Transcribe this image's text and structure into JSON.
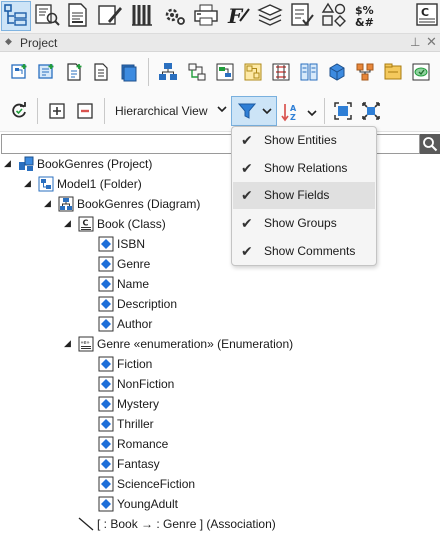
{
  "panel": {
    "title": "Project"
  },
  "top_toolbar": {
    "icons": [
      "model-explorer-icon",
      "search-model-icon",
      "document-icon",
      "edit-diagram-icon",
      "generate-code-icon",
      "settings-icon",
      "print-icon",
      "functions-icon",
      "layers-icon",
      "checklist-icon",
      "shapes-icon",
      "variables-icon",
      "class-c-icon"
    ]
  },
  "toolbar": {
    "view_mode": "Hierarchical View"
  },
  "search": {
    "value": "",
    "placeholder": ""
  },
  "tree": [
    {
      "label": "BookGenres (Project)",
      "icon": "project-icon",
      "expanded": true
    },
    {
      "label": "Model1 (Folder)",
      "icon": "folder-icon",
      "expanded": true
    },
    {
      "label": "BookGenres (Diagram)",
      "icon": "diagram-icon",
      "expanded": true
    },
    {
      "label": "Book (Class)",
      "icon": "class-icon",
      "expanded": true
    },
    {
      "label": "ISBN",
      "icon": "field-icon"
    },
    {
      "label": "Genre",
      "icon": "field-icon"
    },
    {
      "label": "Name",
      "icon": "field-icon"
    },
    {
      "label": "Description",
      "icon": "field-icon"
    },
    {
      "label": "Author",
      "icon": "field-icon"
    },
    {
      "label": "Genre «enumeration» (Enumeration)",
      "icon": "enumeration-icon",
      "expanded": true
    },
    {
      "label": "Fiction",
      "icon": "field-icon"
    },
    {
      "label": "NonFiction",
      "icon": "field-icon"
    },
    {
      "label": "Mystery",
      "icon": "field-icon"
    },
    {
      "label": "Thriller",
      "icon": "field-icon"
    },
    {
      "label": "Romance",
      "icon": "field-icon"
    },
    {
      "label": "Fantasy",
      "icon": "field-icon"
    },
    {
      "label": "ScienceFiction",
      "icon": "field-icon"
    },
    {
      "label": "YoungAdult",
      "icon": "field-icon"
    },
    {
      "label": "[ : Book  →  : Genre ] (Association)",
      "icon": "association-icon"
    }
  ],
  "filter_menu": {
    "items": [
      {
        "label": "Show Entities",
        "checked": true
      },
      {
        "label": "Show Relations",
        "checked": true
      },
      {
        "label": "Show Fields",
        "checked": true,
        "highlighted": true
      },
      {
        "label": "Show Groups",
        "checked": true
      },
      {
        "label": "Show Comments",
        "checked": true
      }
    ]
  },
  "colors": {
    "accent": "#2f7fd6",
    "selected_bg": "#cce4f7",
    "selected_border": "#79b0de",
    "field_icon": "#1e6fd9",
    "menu_hover": "#e0e0e0"
  }
}
